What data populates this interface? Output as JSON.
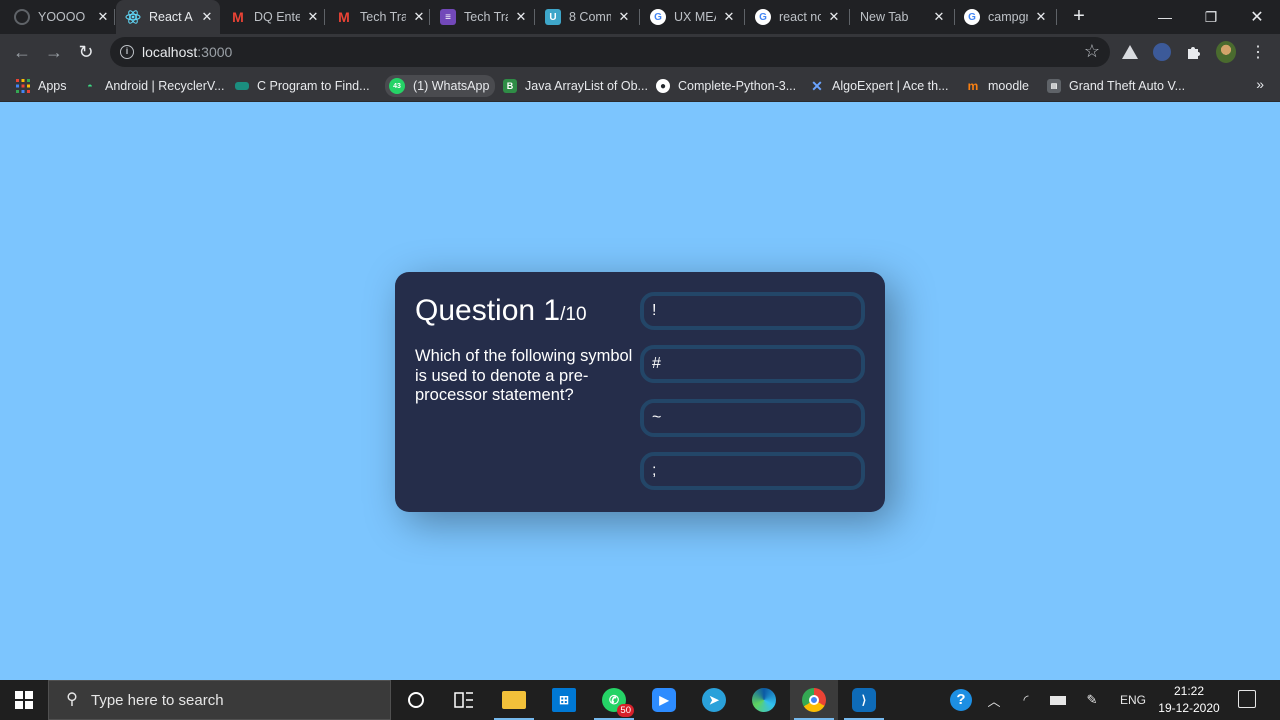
{
  "browser": {
    "tabs": [
      {
        "title": "YOOOO",
        "favicon": "loading-icon",
        "active": false
      },
      {
        "title": "React A",
        "favicon": "react-icon",
        "active": true
      },
      {
        "title": "DQ Ente",
        "favicon": "gmail-icon",
        "active": false
      },
      {
        "title": "Tech Tra",
        "favicon": "gmail-icon",
        "active": false
      },
      {
        "title": "Tech Tra",
        "favicon": "forms-icon",
        "active": false
      },
      {
        "title": "8 Comm",
        "favicon": "u-icon",
        "active": false
      },
      {
        "title": "UX MEA",
        "favicon": "google-icon",
        "active": false
      },
      {
        "title": "react nc",
        "favicon": "google-icon",
        "active": false
      },
      {
        "title": "New Tab",
        "favicon": "none",
        "active": false
      },
      {
        "title": "campgr",
        "favicon": "google-icon",
        "active": false
      }
    ],
    "url_host": "localhost",
    "url_port": ":3000",
    "bookmarks": [
      {
        "label": "Apps",
        "icon": "apps-grid-icon"
      },
      {
        "label": "Android | RecyclerV...",
        "icon": "android-icon"
      },
      {
        "label": "C Program to Find...",
        "icon": "site-icon"
      },
      {
        "label": "(1) WhatsApp",
        "icon": "whatsapp-icon"
      },
      {
        "label": "Java ArrayList of Ob...",
        "icon": "b-icon"
      },
      {
        "label": "Complete-Python-3...",
        "icon": "github-icon"
      },
      {
        "label": "AlgoExpert | Ace th...",
        "icon": "algoexpert-icon"
      },
      {
        "label": "moodle",
        "icon": "moodle-icon"
      },
      {
        "label": "Grand Theft Auto V...",
        "icon": "gta-icon"
      }
    ]
  },
  "quiz": {
    "question_label": "Question 1",
    "question_total": "/10",
    "question_text": "Which of the following symbol is used to denote a pre-processor statement?",
    "answers": [
      "!",
      "#",
      "~",
      ";"
    ]
  },
  "taskbar": {
    "search_placeholder": "Type here to search",
    "whatsapp_badge": "50",
    "language": "ENG",
    "time": "21:22",
    "date": "19-12-2020"
  }
}
